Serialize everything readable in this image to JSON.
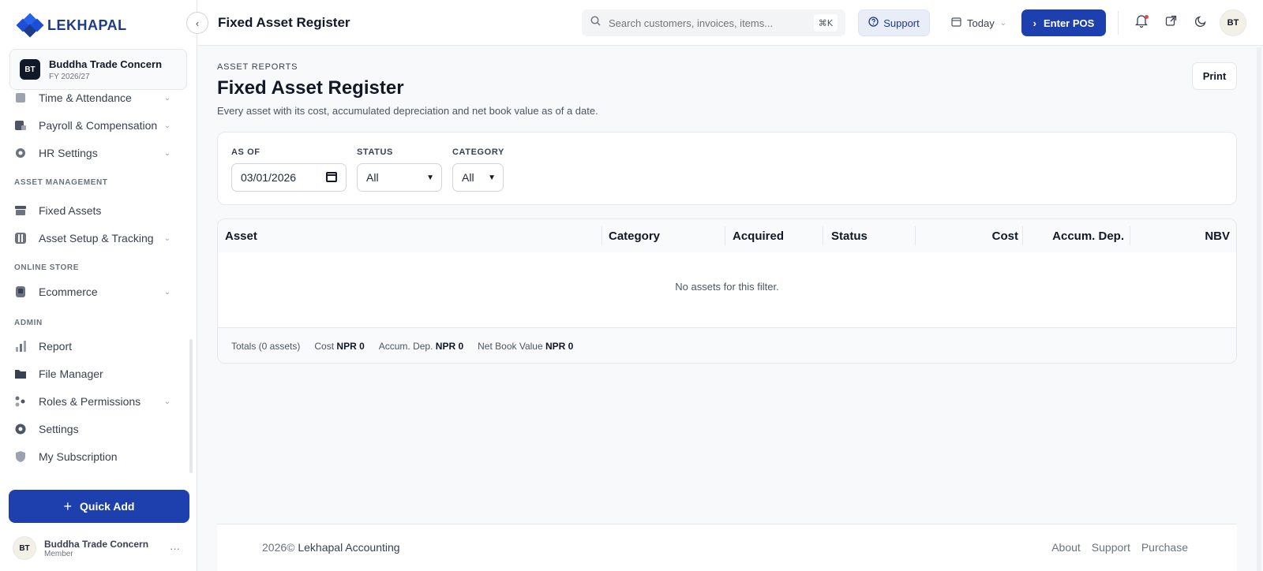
{
  "brand": {
    "name": "LEKHAPAL"
  },
  "org": {
    "initials": "BT",
    "name": "Buddha Trade Concern",
    "fy": "FY 2026/27"
  },
  "sidebar": {
    "items_top": [
      {
        "label": "Time & Attendance",
        "icon": "clock-icon"
      },
      {
        "label": "Payroll & Compensation",
        "icon": "payroll-icon"
      },
      {
        "label": "HR Settings",
        "icon": "gear-icon"
      }
    ],
    "sections": {
      "asset": "ASSET MANAGEMENT",
      "store": "ONLINE STORE",
      "admin": "ADMIN"
    },
    "asset_items": [
      {
        "label": "Fixed Assets",
        "icon": "archive-icon"
      },
      {
        "label": "Asset Setup & Tracking",
        "icon": "sliders-icon"
      }
    ],
    "store_items": [
      {
        "label": "Ecommerce",
        "icon": "store-icon"
      }
    ],
    "admin_items": [
      {
        "label": "Report",
        "icon": "bar-chart-icon"
      },
      {
        "label": "File Manager",
        "icon": "folder-icon"
      },
      {
        "label": "Roles & Permissions",
        "icon": "users-icon"
      },
      {
        "label": "Settings",
        "icon": "cog-icon"
      },
      {
        "label": "My Subscription",
        "icon": "shield-icon"
      }
    ],
    "quick_add": "Quick Add"
  },
  "user": {
    "initials": "BT",
    "name": "Buddha Trade Concern",
    "role": "Member"
  },
  "topbar": {
    "title": "Fixed Asset Register",
    "search_placeholder": "Search customers, invoices, items...",
    "search_shortcut": "⌘K",
    "support": "Support",
    "date_range": "Today",
    "enter_pos": "Enter POS",
    "avatar": "BT"
  },
  "page": {
    "eyebrow": "ASSET REPORTS",
    "title": "Fixed Asset Register",
    "subtitle": "Every asset with its cost, accumulated depreciation and net book value as of a date.",
    "print": "Print"
  },
  "filters": {
    "as_of_label": "AS OF",
    "as_of_value": "03/01/2026",
    "status_label": "STATUS",
    "status_value": "All",
    "category_label": "CATEGORY",
    "category_value": "All"
  },
  "table": {
    "columns": [
      "Asset",
      "Category",
      "Acquired",
      "Status",
      "Cost",
      "Accum. Dep.",
      "NBV"
    ],
    "empty": "No assets for this filter.",
    "totals": {
      "label": "Totals (0 assets)",
      "cost_label": "Cost",
      "cost_value": "NPR 0",
      "dep_label": "Accum. Dep.",
      "dep_value": "NPR 0",
      "nbv_label": "Net Book Value",
      "nbv_value": "NPR 0"
    }
  },
  "footer": {
    "year": "2026©",
    "company": "Lekhapal Accounting",
    "links": [
      "About",
      "Support",
      "Purchase"
    ]
  },
  "colors": {
    "primary": "#1e40af",
    "brand": "#1d4ed8",
    "notification": "#ef4444"
  }
}
